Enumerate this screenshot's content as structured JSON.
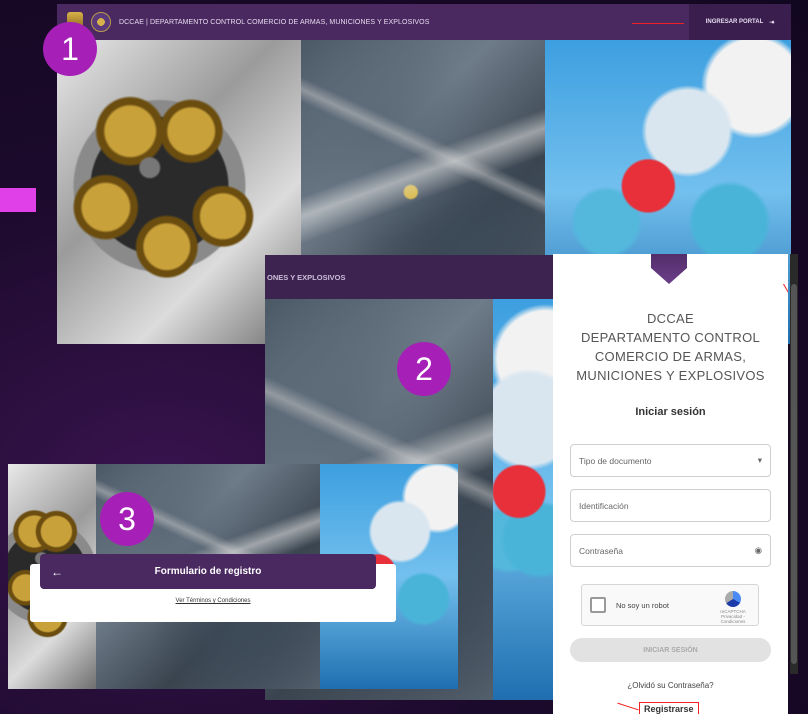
{
  "step_badges": [
    "1",
    "2",
    "3"
  ],
  "portal_header": {
    "title": "DCCAE | DEPARTAMENTO CONTROL COMERCIO DE ARMAS, MUNICIONES Y EXPLOSIVOS",
    "portal_button": "INGRESAR PORTAL"
  },
  "zoomed_header_fragment": "ONES Y EXPLOSIVOS",
  "login": {
    "org_lines": [
      "DCCAE",
      "DEPARTAMENTO CONTROL",
      "COMERCIO DE ARMAS,",
      "MUNICIONES Y EXPLOSIVOS"
    ],
    "heading": "Iniciar sesión",
    "doc_type_placeholder": "Tipo de documento",
    "id_placeholder": "Identificación",
    "password_placeholder": "Contraseña",
    "captcha_label": "No soy un robot",
    "captcha_brand": "reCAPTCHA",
    "captcha_terms": "Privacidad - Condiciones",
    "submit_label": "INICIAR SESIÓN",
    "forgot_label": "¿Olvidó su Contraseña?",
    "register_label": "Registrarse"
  },
  "registration": {
    "title": "Formulario de registro",
    "terms_link": "Ver Términos y Condiciones"
  },
  "colors": {
    "brand_purple": "#4a2860",
    "badge_magenta": "#a620b8",
    "highlight_red": "#e22222"
  }
}
